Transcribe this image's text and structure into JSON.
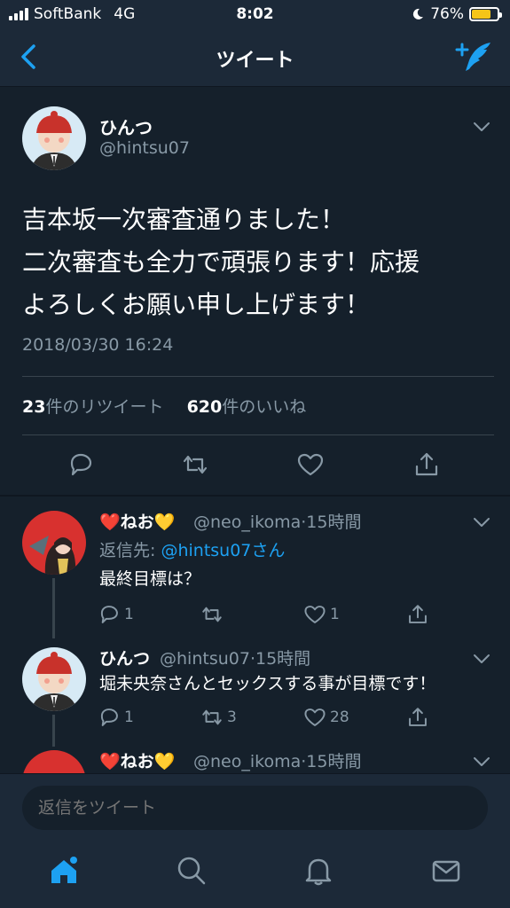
{
  "status_bar": {
    "carrier": "SoftBank",
    "network": "4G",
    "time": "8:02",
    "battery": "76%",
    "battery_level": 0.76,
    "battery_color": "#f5c518"
  },
  "nav": {
    "title": "ツイート",
    "back_icon": "chevron-left-icon",
    "compose_icon": "compose-tweet-icon"
  },
  "main_tweet": {
    "name": "ひんつ",
    "handle": "@hintsu07",
    "text": "吉本坂一次審査通りました！\n二次審査も全力で頑張ります！応援\nよろしくお願い申し上げます！",
    "timestamp": "2018/03/30 16:24",
    "retweets_count": "23",
    "retweets_label": "件のリツイート",
    "likes_count": "620",
    "likes_label": "件のいいね"
  },
  "replies": [
    {
      "name": "❤️ねお💛",
      "handle": "@neo_ikoma",
      "time": "15時間",
      "reply_to_label": "返信先: ",
      "reply_to_target": "@hintsu07さん",
      "text": "最終目標は？",
      "reply_count": "1",
      "retweet_count": "",
      "like_count": "1"
    },
    {
      "name": "ひんつ",
      "handle": "@hintsu07",
      "time": "15時間",
      "text": "堀未央奈さんとセックスする事が目標です！",
      "reply_count": "1",
      "retweet_count": "3",
      "like_count": "28"
    },
    {
      "name": "❤️ねお💛",
      "handle": "@neo_ikoma",
      "time": "15時間"
    }
  ],
  "reply_bar": {
    "placeholder": "返信をツイート"
  },
  "tabs": [
    "home-icon",
    "search-icon",
    "notifications-icon",
    "messages-icon"
  ],
  "colors": {
    "background": "#15202b",
    "bar": "#1c2938",
    "accent": "#1da1f2",
    "muted": "#8899a6"
  }
}
